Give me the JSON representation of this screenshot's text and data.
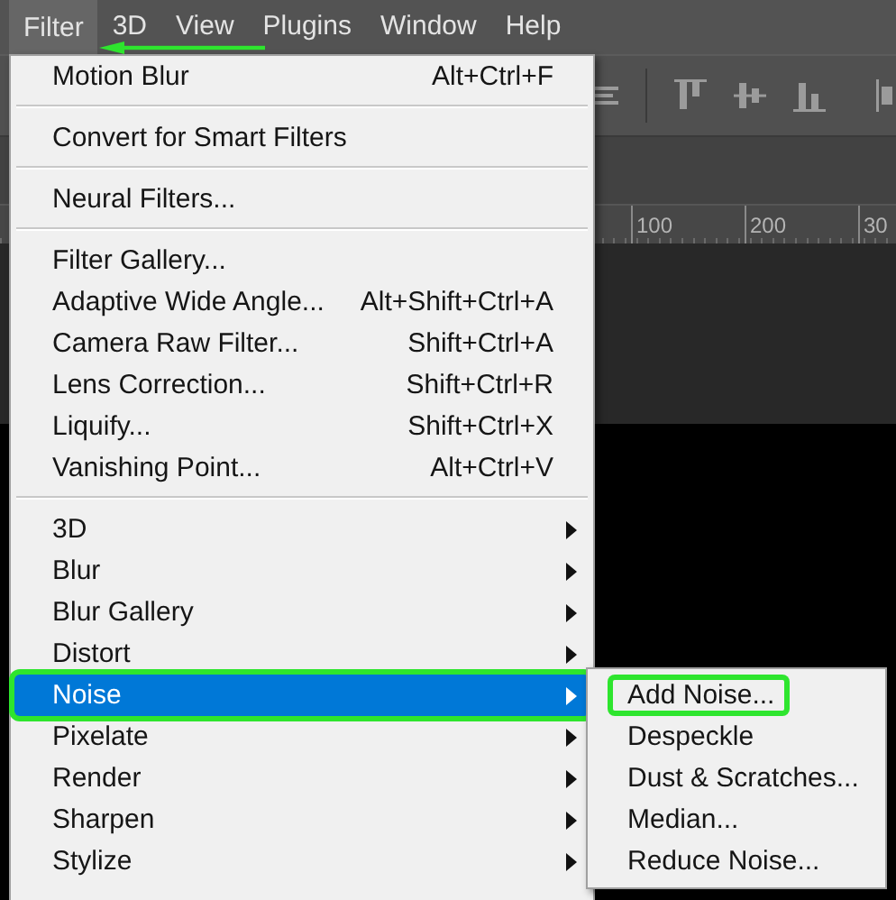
{
  "menu_bar": {
    "items": [
      {
        "label": "Filter",
        "selected": true
      },
      {
        "label": "3D",
        "selected": false
      },
      {
        "label": "View",
        "selected": false
      },
      {
        "label": "Plugins",
        "selected": false
      },
      {
        "label": "Window",
        "selected": false
      },
      {
        "label": "Help",
        "selected": false
      }
    ]
  },
  "filter_menu": {
    "items": [
      {
        "kind": "command",
        "label": "Motion Blur",
        "shortcut": "Alt+Ctrl+F",
        "selected": false,
        "outlined": false
      },
      {
        "kind": "separator"
      },
      {
        "kind": "command",
        "label": "Convert for Smart Filters",
        "selected": false,
        "outlined": false
      },
      {
        "kind": "separator"
      },
      {
        "kind": "command",
        "label": "Neural Filters...",
        "selected": false,
        "outlined": false
      },
      {
        "kind": "separator"
      },
      {
        "kind": "command",
        "label": "Filter Gallery...",
        "selected": false,
        "outlined": false
      },
      {
        "kind": "command",
        "label": "Adaptive Wide Angle...",
        "shortcut": "Alt+Shift+Ctrl+A",
        "selected": false,
        "outlined": false
      },
      {
        "kind": "command",
        "label": "Camera Raw Filter...",
        "shortcut": "Shift+Ctrl+A",
        "selected": false,
        "outlined": false
      },
      {
        "kind": "command",
        "label": "Lens Correction...",
        "shortcut": "Shift+Ctrl+R",
        "selected": false,
        "outlined": false
      },
      {
        "kind": "command",
        "label": "Liquify...",
        "shortcut": "Shift+Ctrl+X",
        "selected": false,
        "outlined": false
      },
      {
        "kind": "command",
        "label": "Vanishing Point...",
        "shortcut": "Alt+Ctrl+V",
        "selected": false,
        "outlined": false
      },
      {
        "kind": "separator"
      },
      {
        "kind": "submenu",
        "label": "3D",
        "selected": false,
        "outlined": false
      },
      {
        "kind": "submenu",
        "label": "Blur",
        "selected": false,
        "outlined": false
      },
      {
        "kind": "submenu",
        "label": "Blur Gallery",
        "selected": false,
        "outlined": false
      },
      {
        "kind": "submenu",
        "label": "Distort",
        "selected": false,
        "outlined": false
      },
      {
        "kind": "submenu",
        "label": "Noise",
        "selected": true,
        "outlined": true
      },
      {
        "kind": "submenu",
        "label": "Pixelate",
        "selected": false,
        "outlined": false
      },
      {
        "kind": "submenu",
        "label": "Render",
        "selected": false,
        "outlined": false
      },
      {
        "kind": "submenu",
        "label": "Sharpen",
        "selected": false,
        "outlined": false
      },
      {
        "kind": "submenu",
        "label": "Stylize",
        "selected": false,
        "outlined": false
      }
    ]
  },
  "noise_submenu": {
    "items": [
      {
        "label": "Add Noise...",
        "selected": false,
        "outlined": true
      },
      {
        "label": "Despeckle",
        "selected": false,
        "outlined": false
      },
      {
        "label": "Dust & Scratches...",
        "selected": false,
        "outlined": false
      },
      {
        "label": "Median...",
        "selected": false,
        "outlined": false
      },
      {
        "label": "Reduce Noise...",
        "selected": false,
        "outlined": false
      }
    ]
  },
  "ruler": {
    "labels": [
      "100",
      "200",
      "30"
    ]
  }
}
